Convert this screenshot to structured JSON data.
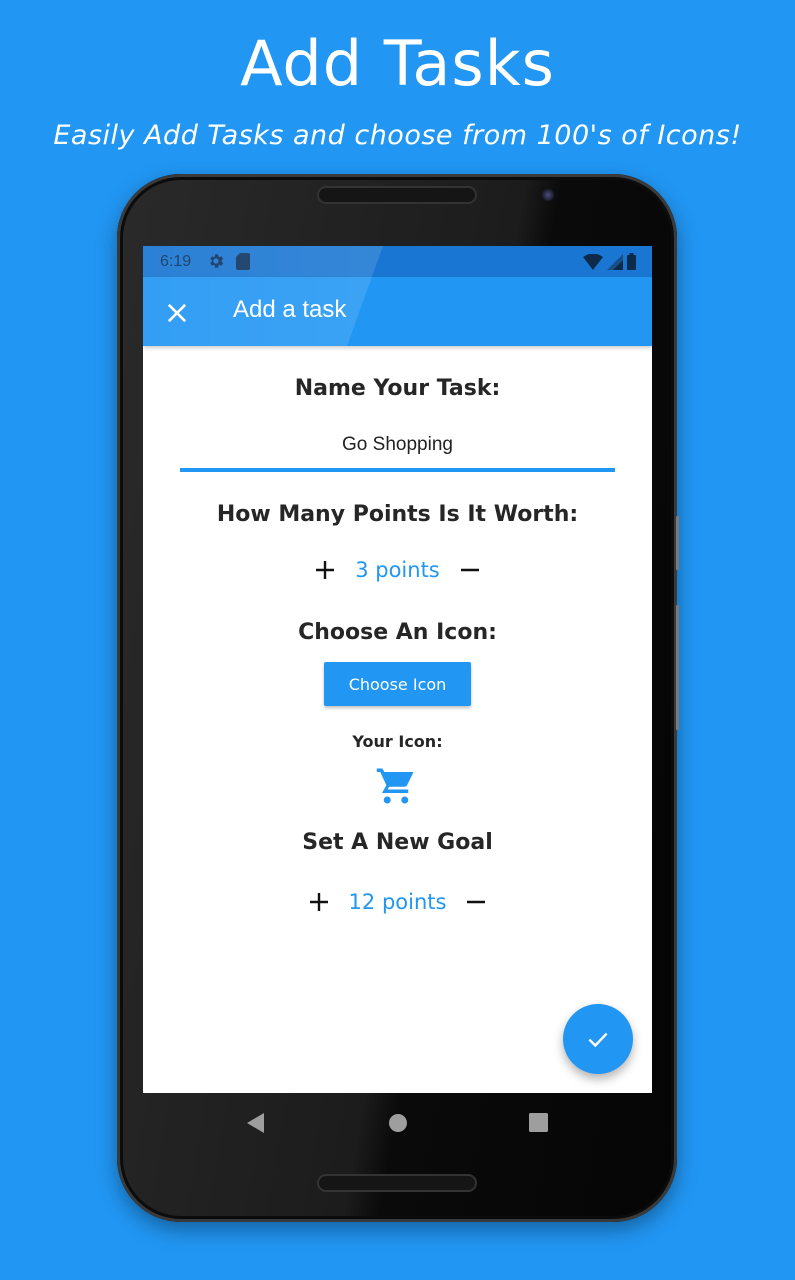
{
  "promo": {
    "title": "Add Tasks",
    "subtitle": "Easily Add Tasks and choose from 100's of Icons!"
  },
  "status_bar": {
    "time": "6:19",
    "left_icons": [
      "gear-icon",
      "sd-card-icon"
    ],
    "right_icons": [
      "wifi-icon",
      "signal-icon",
      "battery-icon"
    ]
  },
  "app_bar": {
    "title": "Add a task",
    "close_icon": "close-icon"
  },
  "form": {
    "name_heading": "Name Your Task:",
    "name_value": "Go Shopping",
    "points_heading": "How Many Points Is It Worth:",
    "points_value": "3 points",
    "icon_heading": "Choose An Icon:",
    "choose_icon_label": "Choose Icon",
    "your_icon_label": "Your Icon:",
    "selected_icon": "shopping-cart-icon",
    "goal_heading": "Set A New Goal",
    "goal_value": "12 points",
    "increment_icon": "plus-icon",
    "decrement_icon": "minus-icon"
  },
  "fab": {
    "icon": "check-icon"
  },
  "nav_bar": {
    "items": [
      "back",
      "home",
      "recents"
    ]
  },
  "colors": {
    "background": "#2196F3",
    "primary": "#2196F3",
    "status_bar": "#1976D2",
    "heading_text": "#262626"
  }
}
